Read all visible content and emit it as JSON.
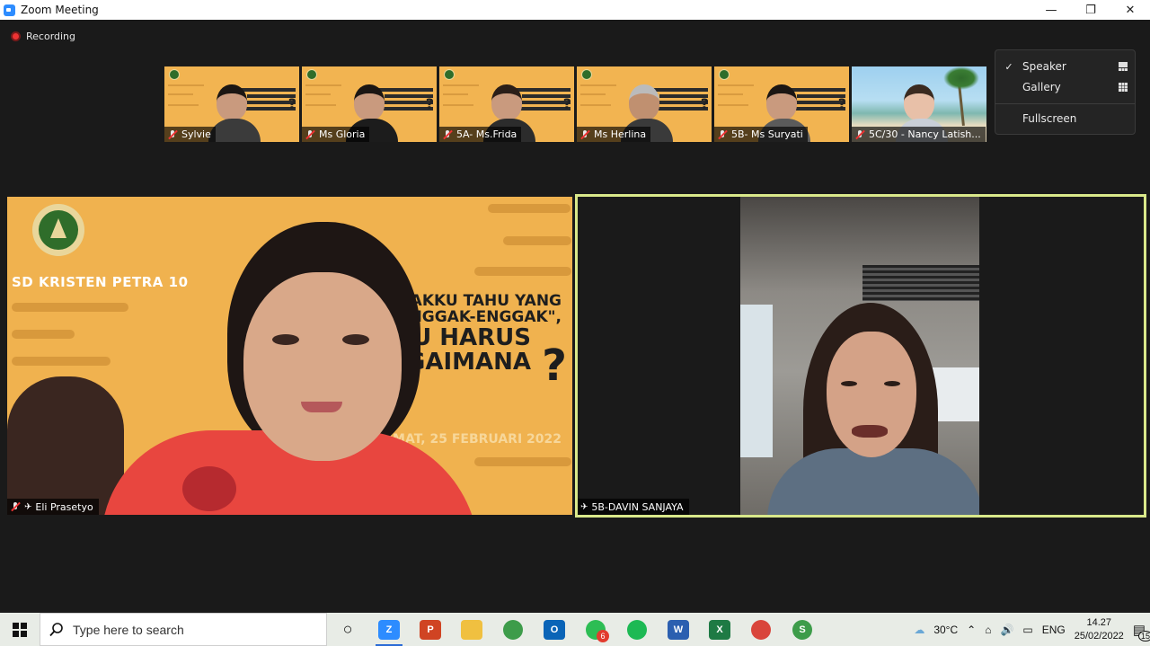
{
  "window": {
    "title": "Zoom Meeting",
    "minimize": "—",
    "restore": "❐",
    "close": "✕"
  },
  "recording": {
    "label": "Recording"
  },
  "thumbnails": [
    {
      "name": "Sylvie",
      "bg": "slide"
    },
    {
      "name": "Ms Gloria",
      "bg": "slide"
    },
    {
      "name": "5A- Ms.Frida",
      "bg": "slide"
    },
    {
      "name": "Ms Herlina",
      "bg": "slide"
    },
    {
      "name": "5B-  Ms Suryati",
      "bg": "slide"
    },
    {
      "name": "5C/30 - Nancy Latish...",
      "bg": "beach"
    }
  ],
  "view_menu": {
    "items": [
      {
        "label": "Speaker",
        "checked": true,
        "icon": "speaker-grid-icon"
      },
      {
        "label": "Gallery",
        "checked": false,
        "icon": "gallery-grid-icon"
      },
      {
        "label": "Fullscreen",
        "checked": false,
        "icon": ""
      }
    ]
  },
  "main_left": {
    "name": "Eli Prasetyo",
    "slide": {
      "school": "SD KRISTEN PETRA 10",
      "line1": "ANAKKU TAHU YANG",
      "line2": "\"ENGGAK-ENGGAK\",",
      "line3": "KU HARUS",
      "line4": "AGAIMANA",
      "qmark": "?",
      "date": "JUMAT, 25 FEBRUARI 2022"
    }
  },
  "main_right": {
    "name": "5B-DAVIN SANJAYA"
  },
  "taskbar": {
    "search_placeholder": "Type here to search",
    "apps": [
      {
        "name": "cortana",
        "label": "○",
        "color": "#000000"
      },
      {
        "name": "zoom",
        "label": "Z",
        "color": "#2d8cff",
        "active": true
      },
      {
        "name": "powerpoint",
        "label": "P",
        "color": "#d04423"
      },
      {
        "name": "file-explorer",
        "label": "",
        "color": "#f0c040"
      },
      {
        "name": "chrome",
        "label": "",
        "color": "#3d9c4a"
      },
      {
        "name": "outlook",
        "label": "O",
        "color": "#0a64b7"
      },
      {
        "name": "whatsapp",
        "label": "",
        "color": "#2dbd54",
        "badge": "6"
      },
      {
        "name": "spotify",
        "label": "",
        "color": "#1db954"
      },
      {
        "name": "word",
        "label": "W",
        "color": "#2b5fb0"
      },
      {
        "name": "excel",
        "label": "X",
        "color": "#1e7a44"
      },
      {
        "name": "chrome-2",
        "label": "",
        "color": "#d9453b"
      },
      {
        "name": "chrome-3",
        "label": "S",
        "color": "#3d9c4a"
      }
    ],
    "weather": "30°C",
    "language": "ENG",
    "time": "14.27",
    "date": "25/02/2022",
    "notifications": "15"
  },
  "colors": {
    "accent": "#d9e88a",
    "recording": "#ee3333",
    "slide": "#f0b24f"
  }
}
